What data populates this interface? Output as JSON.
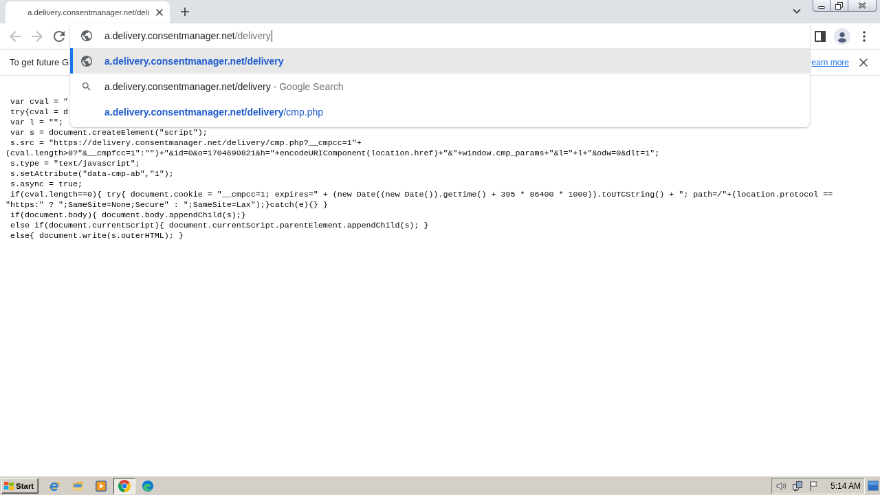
{
  "window": {
    "tabs": [
      {
        "title": "a.delivery.consentmanager.net/deli",
        "selected": true
      }
    ]
  },
  "toolbar": {
    "back": {
      "disabled": true
    },
    "forward": {
      "disabled": true
    }
  },
  "omnibox": {
    "host": "a.delivery.consentmanager.net",
    "path": "/delivery",
    "suggestions": [
      {
        "kind": "url",
        "match": "a.delivery.consentmanager.net/delivery",
        "selected": true
      },
      {
        "kind": "search",
        "match": "a.delivery.consentmanager.net/delivery",
        "rest": " - Google Search",
        "selected": false
      },
      {
        "kind": "link",
        "match": "a.delivery.consentmanager.net/delivery",
        "rest": "/cmp.php",
        "selected": false
      }
    ]
  },
  "infobar": {
    "message": "To get future G",
    "link": "earn more"
  },
  "page": {
    "code_lines": [
      " var cval = \"",
      " try{cval = d",
      " var l = \"\";",
      " var s = document.createElement(\"script\");",
      " s.src = \"https://delivery.consentmanager.net/delivery/cmp.php?__cmpcc=1\"+",
      "(cval.length>0?\"&__cmpfcc=1\":\"\")+\"&id=0&o=1704690821&h=\"+encodeURIComponent(location.href)+\"&\"+window.cmp_params+\"&l=\"+l+\"&odw=0&dlt=1\";",
      " s.type = \"text/javascript\";",
      " s.setAttribute(\"data-cmp-ab\",\"1\");",
      " s.async = true;",
      " if(cval.length==0){ try{ document.cookie = \"__cmpcc=1; expires=\" + (new Date((new Date()).getTime() + 395 * 86400 * 1000)).toUTCString() + \"; path=/\"+(location.protocol ==",
      "\"https:\" ? \";SameSite=None;Secure\" : \";SameSite=Lax\");}catch(e){} }",
      " if(document.body){ document.body.appendChild(s);}",
      " else if(document.currentScript){ document.currentScript.parentElement.appendChild(s); }",
      " else{ document.write(s.outerHTML); }"
    ]
  },
  "taskbar": {
    "start": "Start",
    "apps": [
      {
        "kind": "letter",
        "selected": false
      },
      {
        "kind": "folder",
        "selected": false
      },
      {
        "kind": "player",
        "selected": false
      },
      {
        "kind": "ring",
        "selected": true
      },
      {
        "kind": "swirl",
        "selected": false
      }
    ],
    "clock": "5:14 AM"
  }
}
